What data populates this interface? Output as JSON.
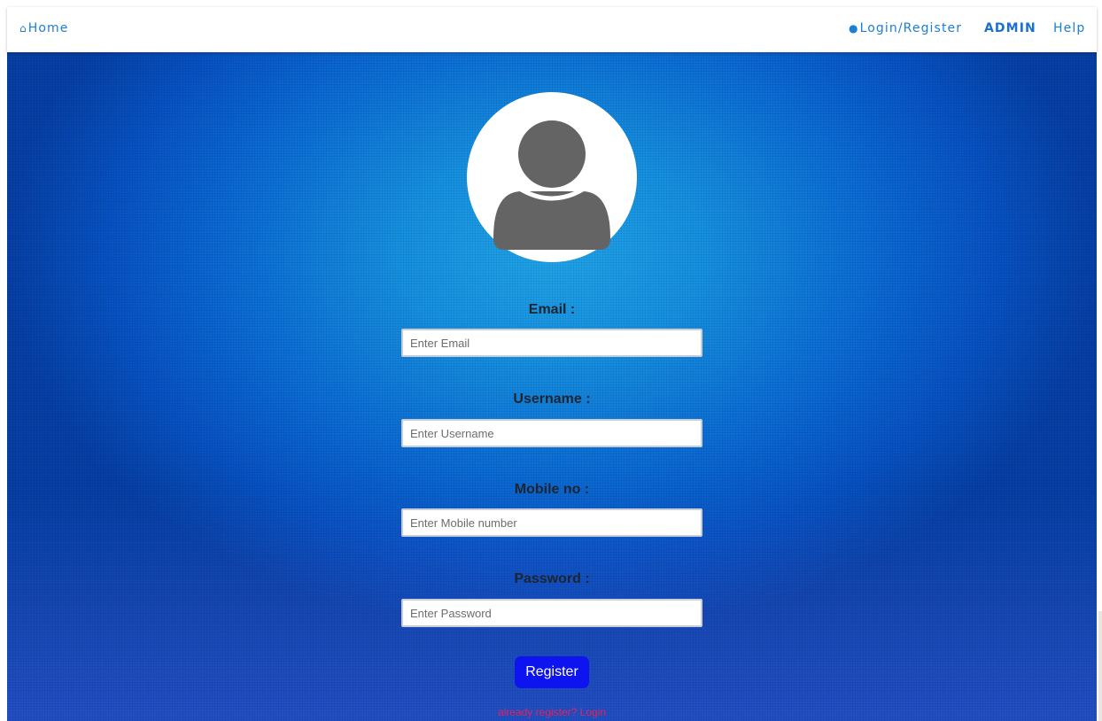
{
  "navbar": {
    "home_label": "Home",
    "login_register_label": "Login/Register",
    "admin_label": "ADMIN",
    "help_label": "Help"
  },
  "icons": {
    "home": "home-icon",
    "user": "user-icon",
    "avatar": "user-avatar-icon"
  },
  "form": {
    "email": {
      "label": "Email :",
      "placeholder": "Enter Email"
    },
    "username": {
      "label": "Username :",
      "placeholder": "Enter Username"
    },
    "mobile": {
      "label": "Mobile no :",
      "placeholder": "Enter Mobile number"
    },
    "password": {
      "label": "Password :",
      "placeholder": "Enter Password"
    },
    "register_label": "Register",
    "login_link": "already register? Login"
  },
  "colors": {
    "accent": "#1c7ed6",
    "button": "#0d14f0",
    "link": "#e0245e",
    "background": "#0c6fd6"
  }
}
